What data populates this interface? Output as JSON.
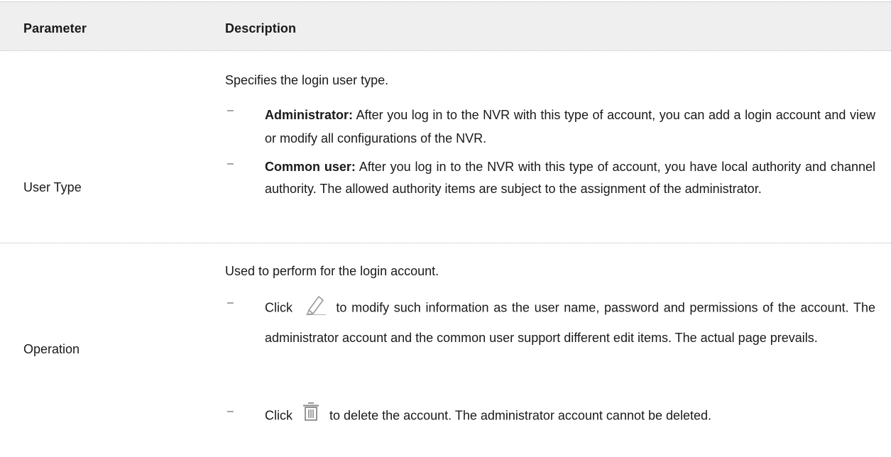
{
  "header": {
    "parameter": "Parameter",
    "description": "Description"
  },
  "rows": [
    {
      "parameter": "User Type",
      "intro": "Specifies the login user type.",
      "items": [
        {
          "bold": "Administrator:",
          "text": " After you log in to the NVR with this type of account, you can add a login account and view or modify all configurations of the NVR."
        },
        {
          "bold": "Common user:",
          "text": " After you log in to the NVR with this type of account, you have local authority and channel authority. The allowed authority items are subject to the assignment of the administrator."
        }
      ]
    },
    {
      "parameter": "Operation",
      "intro": "Used to perform for the login account.",
      "items": [
        {
          "prefix": "Click",
          "icon": "edit-pencil-icon",
          "text": "to modify such information as the user name, password and permissions of the account. The administrator account and the common user support different edit items. The actual page prevails."
        },
        {
          "prefix": "Click",
          "icon": "trash-bin-icon",
          "text": "to delete the account. The administrator account cannot be deleted."
        }
      ]
    }
  ],
  "bullet": "–"
}
